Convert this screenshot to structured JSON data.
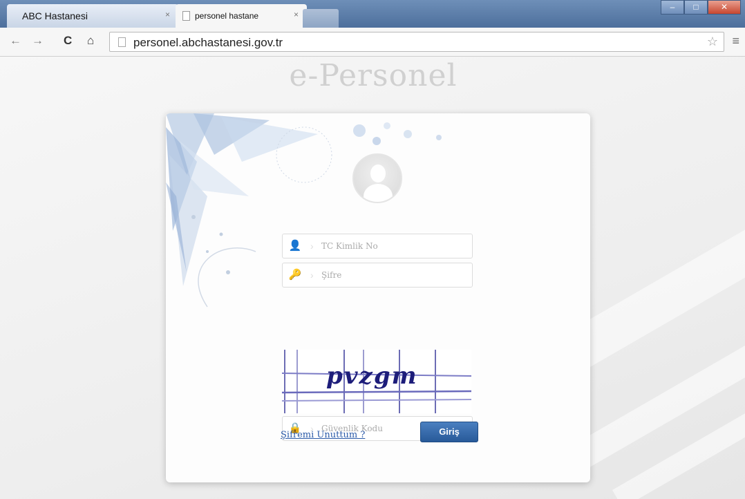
{
  "browser": {
    "tabs": [
      {
        "label": "ABC Hastanesi",
        "close": "×"
      },
      {
        "label": "personel hastane",
        "close": "×"
      }
    ],
    "window_buttons": {
      "minimize": "–",
      "maximize": "□",
      "close": "✕"
    },
    "nav": {
      "back": "←",
      "forward": "→",
      "reload": "C",
      "home": "⌂"
    },
    "url": "personel.abchastanesi.gov.tr",
    "star": "☆",
    "menu": "≡"
  },
  "page": {
    "logo": "e-Personel",
    "login": {
      "tc_placeholder": "TC Kimlik No",
      "password_placeholder": "Şifre",
      "captcha_text": "pvzgm",
      "security_placeholder": "Güvenlik Kodu",
      "forgot_link": "Şifremi Unuttum ?",
      "submit_label": "Giriş"
    }
  },
  "colors": {
    "accent": "#2f64a8",
    "link": "#2a5aa8",
    "captcha_ink": "#1d1d7a"
  }
}
